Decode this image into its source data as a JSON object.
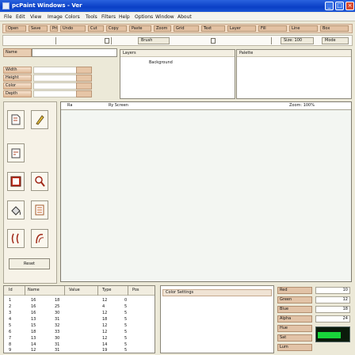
{
  "window": {
    "title": "pcPaint Windows - Ver",
    "controls": [
      "_",
      "□",
      "×"
    ]
  },
  "menubar": [
    "File",
    "Edit",
    "View",
    "Image",
    "Colors",
    "Tools",
    "Filters",
    "Help",
    "Options",
    "Window",
    "About"
  ],
  "toolbar_row1": [
    "Open",
    "Save",
    "Print",
    "Undo",
    "Cut",
    "Copy",
    "Paste",
    "Zoom",
    "Grid",
    "Text",
    "Layer",
    "Fill",
    "Line",
    "Box"
  ],
  "toolbar_row2": {
    "left_pill": "Brush",
    "right_pill_1": "Size: 100",
    "right_pill_2": "Mode"
  },
  "fields": {
    "name_label": "Name",
    "name_value": ""
  },
  "properties": [
    "Width",
    "Height",
    "Color",
    "Depth"
  ],
  "panes": {
    "left": {
      "header": "Layers",
      "lines": [
        "Background"
      ]
    },
    "right": {
      "header": "Palette",
      "lines": []
    }
  },
  "tool_icons": [
    "select-tool",
    "brush-tool",
    "eraser-tool",
    "image-tool",
    "zoom-tool",
    "fill-tool",
    "text-tool",
    "clone-tool",
    "curve-tool"
  ],
  "tool_bottom_button": "Reset",
  "canvas": {
    "left_label": "Ra",
    "mid_label": "Ry Screen",
    "right_label": "Zoom: 100%"
  },
  "table": {
    "headers": [
      "Id",
      "Name",
      "Value",
      "Type",
      "Pos"
    ],
    "rows": [
      [
        "1",
        "16",
        "18",
        "12",
        "0"
      ],
      [
        "2",
        "16",
        "25",
        "4",
        "5"
      ],
      [
        "3",
        "16",
        "30",
        "12",
        "5"
      ],
      [
        "4",
        "13",
        "31",
        "18",
        "5"
      ],
      [
        "5",
        "15",
        "32",
        "12",
        "5"
      ],
      [
        "6",
        "18",
        "33",
        "12",
        "5"
      ],
      [
        "7",
        "13",
        "30",
        "12",
        "5"
      ],
      [
        "8",
        "14",
        "31",
        "14",
        "5"
      ],
      [
        "9",
        "12",
        "31",
        "19",
        "5"
      ]
    ]
  },
  "bottom_mid_header": "Color Settings",
  "bottom_right": {
    "rows": [
      {
        "label": "Red",
        "value": "10"
      },
      {
        "label": "Green",
        "value": "12"
      },
      {
        "label": "Blue",
        "value": "18"
      },
      {
        "label": "Alpha",
        "value": "24"
      },
      {
        "label": "Hue",
        "value": ""
      },
      {
        "label": "Sat",
        "value": ""
      },
      {
        "label": "Lum",
        "value": ""
      }
    ],
    "meter_level": 0.72
  },
  "colors": {
    "titlebar": "#0a3fc6",
    "accent": "#e2c1a3",
    "meter": "#18d53a"
  }
}
